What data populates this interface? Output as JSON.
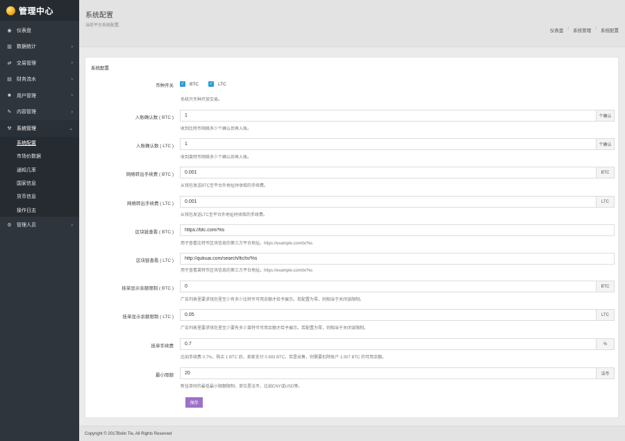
{
  "brand": {
    "title": "管理中心"
  },
  "nav": {
    "items": [
      {
        "label": "仪表盘",
        "icon": "dashboard-icon",
        "glyph": "◉",
        "chevron": ""
      },
      {
        "label": "数据统计",
        "icon": "chart-icon",
        "glyph": "▥",
        "chevron": "›"
      },
      {
        "label": "交易管理",
        "icon": "exchange-icon",
        "glyph": "⇄",
        "chevron": "›"
      },
      {
        "label": "财务流水",
        "icon": "finance-icon",
        "glyph": "▤",
        "chevron": "›"
      },
      {
        "label": "用户管理",
        "icon": "users-icon",
        "glyph": "☻",
        "chevron": "›"
      },
      {
        "label": "内容管理",
        "icon": "content-icon",
        "glyph": "✎",
        "chevron": "›"
      },
      {
        "label": "系统管理",
        "icon": "wrench-icon",
        "glyph": "⚒",
        "chevron": "⌄"
      }
    ],
    "sub_items": [
      "系统配置",
      "市场价数据",
      "通知几率",
      "国家信息",
      "货币信息",
      "操作日志"
    ],
    "last_item": {
      "label": "管理人员",
      "icon": "gears-icon",
      "glyph": "⚙",
      "chevron": "›"
    }
  },
  "header": {
    "title": "系统配置",
    "subtitle": "当前平台系统配置.",
    "breadcrumb": [
      "仪表盘",
      "系统管理",
      "系统配置"
    ],
    "breadcrumb_sep": "/"
  },
  "panel": {
    "title": "系统配置"
  },
  "form": {
    "currency": {
      "label": "币种开关",
      "options": [
        "BTC",
        "LTC"
      ],
      "help": "系统只币种开放交易。"
    },
    "btc_confirm": {
      "label": "入账确认数 ( BTC )",
      "value": "1",
      "addon": "个确认",
      "help": "收到比特币网络多少个确认后再入账。"
    },
    "ltc_confirm": {
      "label": "入账确认数 ( LTC )",
      "value": "1",
      "addon": "个确认",
      "help": "收到莱特币网络多少个确认后再入账。"
    },
    "btc_fee": {
      "label": "网络转出手续费 ( BTC )",
      "value": "0.001",
      "addon": "BTC",
      "help": "从钱包发送BTC至平台外地址时收取的手续费。"
    },
    "ltc_fee": {
      "label": "网络转出手续费 ( LTC )",
      "value": "0.001",
      "addon": "LTC",
      "help": "从钱包发送LTC至平台外地址时收取的手续费。"
    },
    "btc_explorer": {
      "label": "区块链查看 ( BTC )",
      "value": "https://btc.com/%s",
      "help": "用于查看比特币区块信息的第三方平台地址。https://example.com/tx/%s"
    },
    "ltc_explorer": {
      "label": "区块链查看 ( LTC )",
      "value": "http://qukuai.com/search/ltc/tx/%s",
      "help": "用于查看莱特币区块信息的第三方平台地址。https://example.com/tx/%s"
    },
    "btc_depth": {
      "label": "挂单显示余额限制 ( BTC )",
      "value": "0",
      "addon": "BTC",
      "help": "广告列表里要求钱包里至少有多少比特币可用余额才给予展示。若配置为零，则相当于关闭该限制。"
    },
    "ltc_depth": {
      "label": "挂单显示余额限制 ( LTC )",
      "value": "0.05",
      "addon": "LTC",
      "help": "广告列表里要求钱包里至少要有多少莱特币可用余额才给予展示。若配置为零，则相当于关闭该限制。"
    },
    "maker_fee": {
      "label": "挂单手续费",
      "value": "0.7",
      "addon": "%",
      "help": "比如手续费 0.7%，购买 1 BTC 后，卖家支付 0.993 BTC，若是出售，则需要扣除账户 1.007 BTC 的可用余额。"
    },
    "min_limit": {
      "label": "最小限额",
      "value": "20",
      "addon": "法币",
      "help": "新挂单时的最低最小限额限制，单位是法币，比如CNY或USD等。"
    }
  },
  "save_label": "保存",
  "footer": {
    "text": "Copyright © 2017Bolin Tie, All Rights Reserved"
  },
  "colors": {
    "sidebar": "#2f353d",
    "accent_checkbox": "#2f9bd8",
    "save_button": "#9b71c9"
  }
}
